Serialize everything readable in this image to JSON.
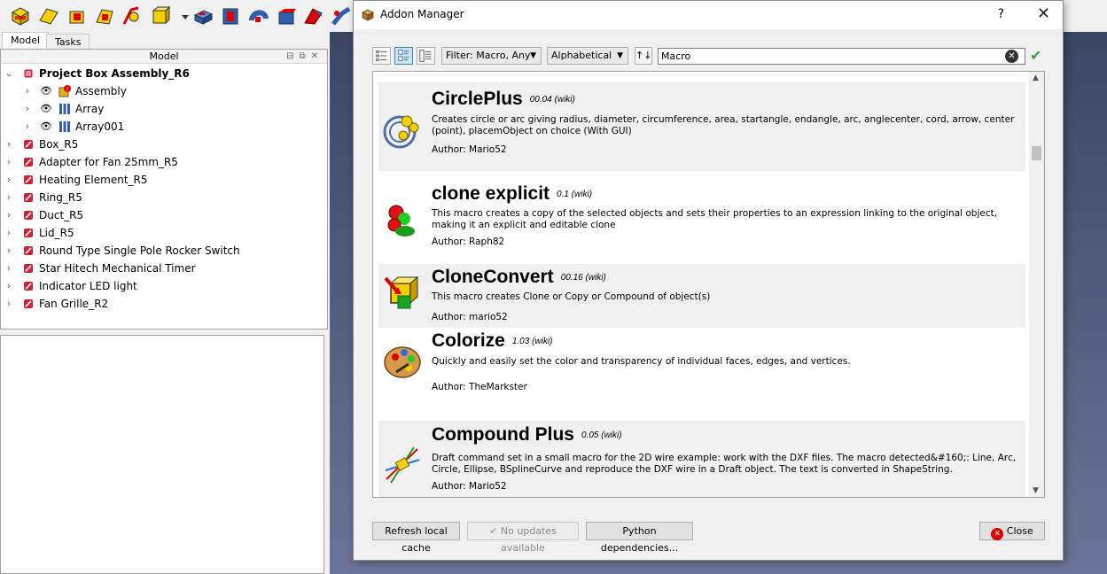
{
  "main": {
    "tabs": [
      "Model",
      "Tasks"
    ],
    "model_header": "Model",
    "tree": [
      {
        "label": "Project Box Assembly_R6",
        "bold": true,
        "level": 0,
        "expanded": true,
        "eye": false
      },
      {
        "label": "Assembly",
        "level": 1,
        "eye": true,
        "icon": "assembly-warning-icon"
      },
      {
        "label": "Array",
        "level": 1,
        "eye": true,
        "icon": "array-icon"
      },
      {
        "label": "Array001",
        "level": 1,
        "eye": true,
        "icon": "array-icon"
      },
      {
        "label": "Box_R5",
        "level": 0,
        "icon": "link-icon"
      },
      {
        "label": "Adapter for Fan 25mm_R5",
        "level": 0,
        "icon": "link-icon"
      },
      {
        "label": "Heating Element_R5",
        "level": 0,
        "icon": "link-icon"
      },
      {
        "label": "Ring_R5",
        "level": 0,
        "icon": "link-icon"
      },
      {
        "label": "Duct_R5",
        "level": 0,
        "icon": "link-icon"
      },
      {
        "label": "Lid_R5",
        "level": 0,
        "icon": "link-icon"
      },
      {
        "label": "Round Type Single Pole Rocker Switch",
        "level": 0,
        "icon": "link-icon"
      },
      {
        "label": "Star Hitech Mechanical Timer",
        "level": 0,
        "icon": "link-icon"
      },
      {
        "label": "Indicator LED light",
        "level": 0,
        "icon": "link-icon"
      },
      {
        "label": "Fan Grille_R2",
        "level": 0,
        "icon": "link-icon"
      }
    ]
  },
  "dialog": {
    "title": "Addon Manager",
    "help": "?",
    "close": "✕",
    "filter": "Filter: Macro, Any",
    "sort": "Alphabetical",
    "search_value": "Macro",
    "macros": [
      {
        "name": "CirclePlus",
        "version": "00.04 (wiki)",
        "description": "Creates circle or arc giving radius, diameter, circumference, area, startangle, endangle, arc, anglecenter, cord, arrow, center (point), placemObject on choice (With GUI)",
        "author": "Author: Mario52"
      },
      {
        "name": "clone explicit",
        "version": "0.1 (wiki)",
        "description": "This macro creates a copy of the selected objects and sets their properties to an expression linking to the original object, making it an explicit and editable clone",
        "author": "Author: Raph82"
      },
      {
        "name": "CloneConvert",
        "version": "00.16 (wiki)",
        "description": "This macro creates Clone or Copy or Compound of object(s)",
        "author": "Author: mario52"
      },
      {
        "name": "Colorize",
        "version": "1.03 (wiki)",
        "description": "Quickly and easily set the color and transparency of individual faces, edges, and vertices.",
        "author": "Author: TheMarkster"
      },
      {
        "name": "Compound Plus",
        "version": "0.05 (wiki)",
        "description": "Draft command set in a small macro for the 2D wire example: work with the DXF files. The macro detected&#160;: Line, Arc, Circle, Ellipse, BSplineCurve and reproduce the DXF wire in a Draft object. The text is converted in ShapeString.",
        "author": "Author: Mario52"
      }
    ],
    "buttons": {
      "refresh": "Refresh local cache",
      "updates": "No updates available",
      "python": "Python dependencies...",
      "close": "Close"
    }
  }
}
